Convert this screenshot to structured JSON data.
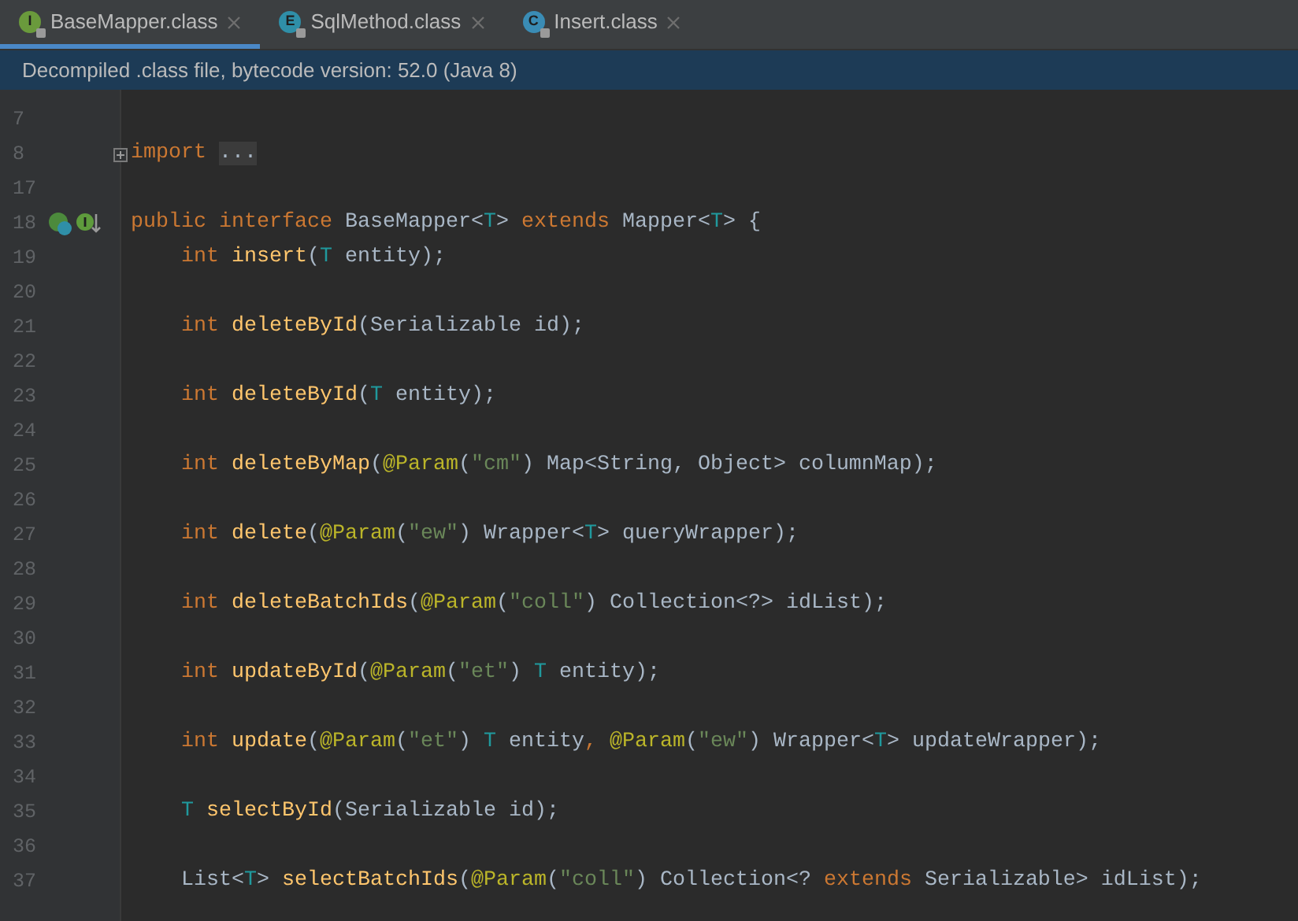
{
  "tabs": [
    {
      "label": "BaseMapper.class",
      "icon_letter": "I",
      "color": "#6a9a3c",
      "selected": true
    },
    {
      "label": "SqlMethod.class",
      "icon_letter": "E",
      "color": "#2f8fa8",
      "selected": false
    },
    {
      "label": "Insert.class",
      "icon_letter": "C",
      "color": "#3a8cb5",
      "selected": false
    }
  ],
  "banner": {
    "text": "Decompiled .class file, bytecode version: 52.0 (Java 8)"
  },
  "editor": {
    "lines": [
      {
        "number": "7"
      },
      {
        "number": "8",
        "foldable": true,
        "tokens": [
          {
            "kind": "keyword",
            "text": "import "
          },
          {
            "kind": "folded",
            "text": "..."
          }
        ]
      },
      {
        "number": "17"
      },
      {
        "number": "18",
        "gutter_icons": true,
        "tokens": [
          {
            "kind": "keyword",
            "text": "public interface "
          },
          {
            "kind": "plain",
            "text": "BaseMapper<"
          },
          {
            "kind": "typevar",
            "text": "T"
          },
          {
            "kind": "plain",
            "text": "> "
          },
          {
            "kind": "keyword",
            "text": "extends "
          },
          {
            "kind": "plain",
            "text": "Mapper<"
          },
          {
            "kind": "typevar",
            "text": "T"
          },
          {
            "kind": "plain",
            "text": "> {"
          }
        ]
      },
      {
        "number": "19",
        "tokens": [
          {
            "kind": "keyword",
            "text": "    int "
          },
          {
            "kind": "method",
            "text": "insert"
          },
          {
            "kind": "plain",
            "text": "("
          },
          {
            "kind": "typevar",
            "text": "T"
          },
          {
            "kind": "plain",
            "text": " entity);"
          }
        ]
      },
      {
        "number": "20"
      },
      {
        "number": "21",
        "tokens": [
          {
            "kind": "keyword",
            "text": "    int "
          },
          {
            "kind": "method",
            "text": "deleteById"
          },
          {
            "kind": "plain",
            "text": "(Serializable id);"
          }
        ]
      },
      {
        "number": "22"
      },
      {
        "number": "23",
        "tokens": [
          {
            "kind": "keyword",
            "text": "    int "
          },
          {
            "kind": "method",
            "text": "deleteById"
          },
          {
            "kind": "plain",
            "text": "("
          },
          {
            "kind": "typevar",
            "text": "T"
          },
          {
            "kind": "plain",
            "text": " entity);"
          }
        ]
      },
      {
        "number": "24"
      },
      {
        "number": "25",
        "tokens": [
          {
            "kind": "keyword",
            "text": "    int "
          },
          {
            "kind": "method",
            "text": "deleteByMap"
          },
          {
            "kind": "plain",
            "text": "("
          },
          {
            "kind": "annotation",
            "text": "@Param"
          },
          {
            "kind": "plain",
            "text": "("
          },
          {
            "kind": "string",
            "text": "\"cm\""
          },
          {
            "kind": "plain",
            "text": ") Map<String, Object> columnMap);"
          }
        ]
      },
      {
        "number": "26"
      },
      {
        "number": "27",
        "tokens": [
          {
            "kind": "keyword",
            "text": "    int "
          },
          {
            "kind": "method",
            "text": "delete"
          },
          {
            "kind": "plain",
            "text": "("
          },
          {
            "kind": "annotation",
            "text": "@Param"
          },
          {
            "kind": "plain",
            "text": "("
          },
          {
            "kind": "string",
            "text": "\"ew\""
          },
          {
            "kind": "plain",
            "text": ") Wrapper<"
          },
          {
            "kind": "typevar",
            "text": "T"
          },
          {
            "kind": "plain",
            "text": "> queryWrapper);"
          }
        ]
      },
      {
        "number": "28"
      },
      {
        "number": "29",
        "tokens": [
          {
            "kind": "keyword",
            "text": "    int "
          },
          {
            "kind": "method",
            "text": "deleteBatchIds"
          },
          {
            "kind": "plain",
            "text": "("
          },
          {
            "kind": "annotation",
            "text": "@Param"
          },
          {
            "kind": "plain",
            "text": "("
          },
          {
            "kind": "string",
            "text": "\"coll\""
          },
          {
            "kind": "plain",
            "text": ") Collection<?> idList);"
          }
        ]
      },
      {
        "number": "30"
      },
      {
        "number": "31",
        "tokens": [
          {
            "kind": "keyword",
            "text": "    int "
          },
          {
            "kind": "method",
            "text": "updateById"
          },
          {
            "kind": "plain",
            "text": "("
          },
          {
            "kind": "annotation",
            "text": "@Param"
          },
          {
            "kind": "plain",
            "text": "("
          },
          {
            "kind": "string",
            "text": "\"et\""
          },
          {
            "kind": "plain",
            "text": ") "
          },
          {
            "kind": "typevar",
            "text": "T"
          },
          {
            "kind": "plain",
            "text": " entity);"
          }
        ]
      },
      {
        "number": "32"
      },
      {
        "number": "33",
        "tokens": [
          {
            "kind": "keyword",
            "text": "    int "
          },
          {
            "kind": "method",
            "text": "update"
          },
          {
            "kind": "plain",
            "text": "("
          },
          {
            "kind": "annotation",
            "text": "@Param"
          },
          {
            "kind": "plain",
            "text": "("
          },
          {
            "kind": "string",
            "text": "\"et\""
          },
          {
            "kind": "plain",
            "text": ") "
          },
          {
            "kind": "typevar",
            "text": "T"
          },
          {
            "kind": "plain",
            "text": " entity"
          },
          {
            "kind": "keyword",
            "text": ", "
          },
          {
            "kind": "annotation",
            "text": "@Param"
          },
          {
            "kind": "plain",
            "text": "("
          },
          {
            "kind": "string",
            "text": "\"ew\""
          },
          {
            "kind": "plain",
            "text": ") Wrapper<"
          },
          {
            "kind": "typevar",
            "text": "T"
          },
          {
            "kind": "plain",
            "text": "> updateWrapper);"
          }
        ]
      },
      {
        "number": "34"
      },
      {
        "number": "35",
        "tokens": [
          {
            "kind": "typevar",
            "text": "    T"
          },
          {
            "kind": "method",
            "text": " selectById"
          },
          {
            "kind": "plain",
            "text": "(Serializable id);"
          }
        ]
      },
      {
        "number": "36"
      },
      {
        "number": "37",
        "tokens": [
          {
            "kind": "plain",
            "text": "    List<"
          },
          {
            "kind": "typevar",
            "text": "T"
          },
          {
            "kind": "plain",
            "text": "> "
          },
          {
            "kind": "method",
            "text": "selectBatchIds"
          },
          {
            "kind": "plain",
            "text": "("
          },
          {
            "kind": "annotation",
            "text": "@Param"
          },
          {
            "kind": "plain",
            "text": "("
          },
          {
            "kind": "string",
            "text": "\"coll\""
          },
          {
            "kind": "plain",
            "text": ") Collection<? "
          },
          {
            "kind": "keyword",
            "text": "extends "
          },
          {
            "kind": "plain",
            "text": "Serializable> idList);"
          }
        ]
      }
    ]
  }
}
